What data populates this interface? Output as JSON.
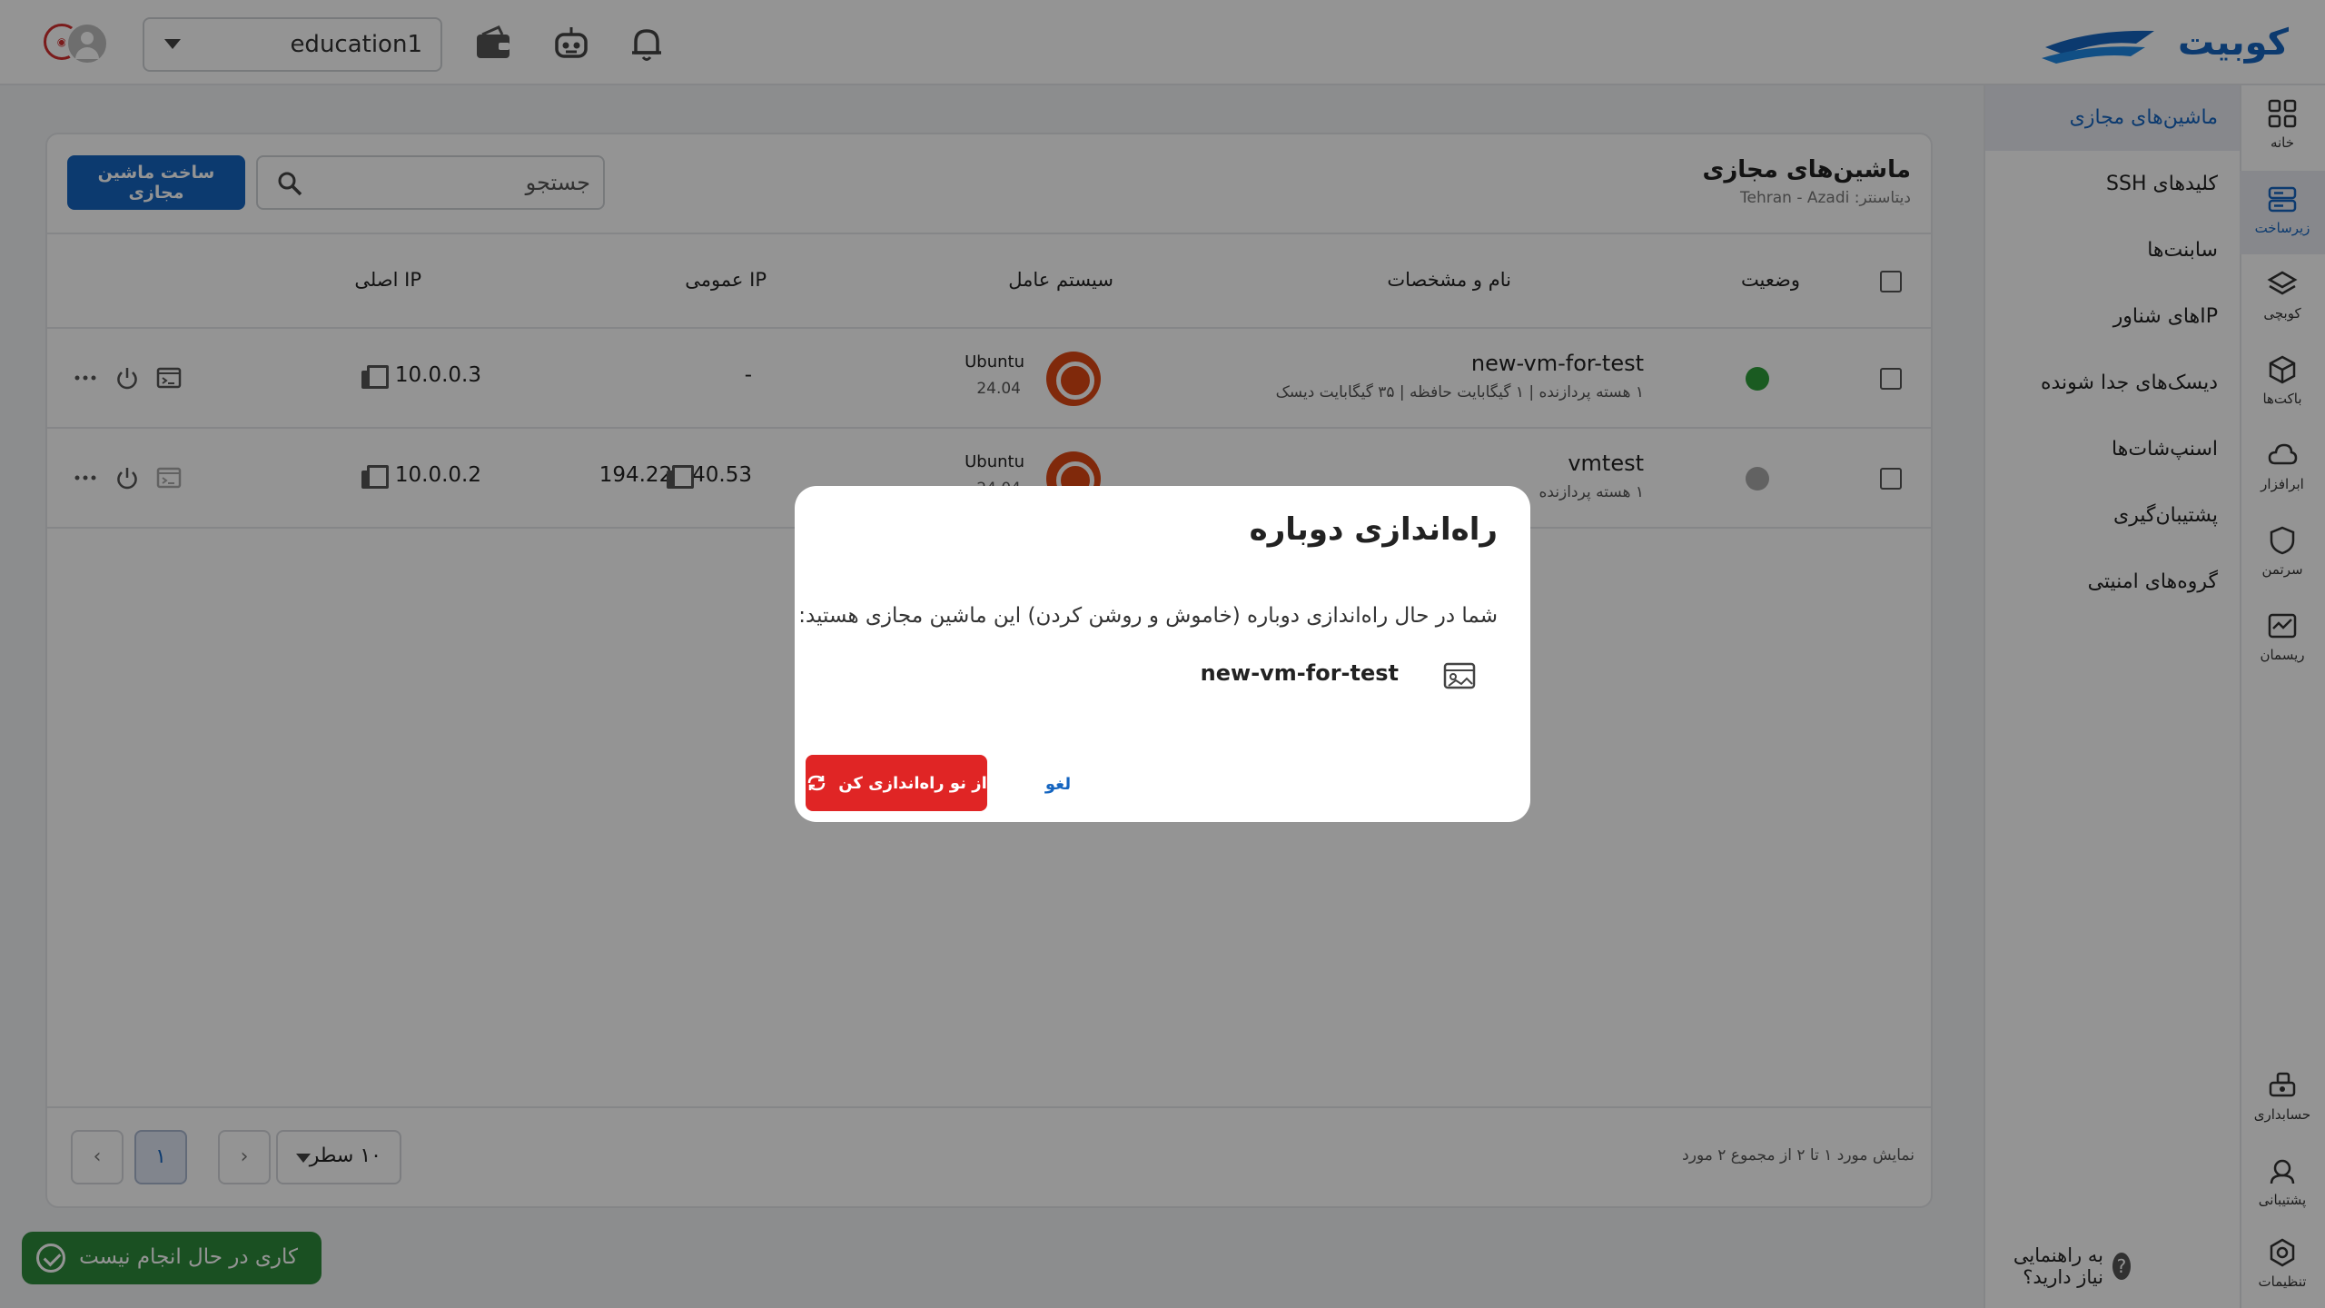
{
  "header": {
    "brand": "کوبیت",
    "project": "education1"
  },
  "rail": [
    {
      "label": "خانه",
      "icon": "home-grid-icon"
    },
    {
      "label": "زیرساخت",
      "icon": "server-icon",
      "active": true
    },
    {
      "label": "کوبچی",
      "icon": "layers-icon"
    },
    {
      "label": "باکت‌ها",
      "icon": "box-icon"
    },
    {
      "label": "ابرافزار",
      "icon": "cloud-icon"
    },
    {
      "label": "سرتمن",
      "icon": "shield-icon"
    },
    {
      "label": "ریسمان",
      "icon": "chart-icon"
    },
    {
      "label": "حسابداری",
      "icon": "accounting-icon"
    },
    {
      "label": "پشتیبانی",
      "icon": "support-icon"
    },
    {
      "label": "تنظیمات",
      "icon": "settings-icon"
    }
  ],
  "subnav": [
    {
      "label": "ماشین‌های مجازی",
      "active": true
    },
    {
      "label": "کلیدهای SSH"
    },
    {
      "label": "سابنت‌ها"
    },
    {
      "label": "IPهای شناور"
    },
    {
      "label": "دیسک‌های جدا شونده"
    },
    {
      "label": "اسنپ‌شات‌ها"
    },
    {
      "label": "پشتیبان‌گیری"
    },
    {
      "label": "گروه‌های امنیتی"
    }
  ],
  "help_text": "به راهنمایی نیاز دارید؟",
  "page": {
    "title": "ماشین‌های مجازی",
    "datacenter": "دیتاسنتر: Tehran - Azadi",
    "create_button": "ساخت ماشین مجازی",
    "search_placeholder": "جستجو"
  },
  "table": {
    "columns": {
      "status": "وضعیت",
      "name": "نام و مشخصات",
      "os": "سیستم عامل",
      "public_ip": "IP عمومی",
      "private_ip": "IP اصلی"
    },
    "rows": [
      {
        "name": "new-vm-for-test",
        "spec": "۱ هسته پردازنده | ۱ گیگابایت حافظه | ۳۵ گیگابایت دیسک",
        "status_color": "#2e9e3a",
        "os_name": "Ubuntu",
        "os_version": "24.04",
        "public_ip": "-",
        "private_ip": "10.0.0.3"
      },
      {
        "name": "vmtest",
        "spec": "۱ هسته پردازنده",
        "status_color": "#a9a9a9",
        "os_name": "Ubuntu",
        "os_version": "24.04",
        "public_ip": "194.225.40.53",
        "private_ip": "10.0.0.2"
      }
    ]
  },
  "footer": {
    "summary": "نمایش مورد ۱ تا ۲ از مجموع ۲ مورد",
    "rows_per_page": "۱۰ سطر",
    "current_page": "۱"
  },
  "toast": "کاری در حال انجام نیست",
  "modal": {
    "title": "راه‌اندازی دوباره",
    "text": "شما در حال راه‌اندازی دوباره (خاموش و روشن کردن) این ماشین مجازی هستید:",
    "vm_name": "new-vm-for-test",
    "confirm": "از نو راه‌اندازی کن",
    "cancel": "لغو"
  },
  "colors": {
    "primary": "#1565c0",
    "danger": "#e02525",
    "success": "#2e8b3c"
  }
}
